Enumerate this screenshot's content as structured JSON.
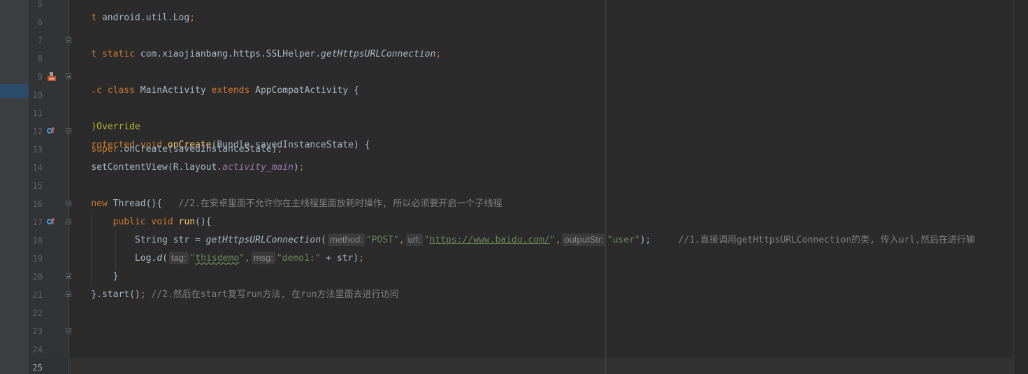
{
  "editor": {
    "line_numbers": [
      "5",
      "6",
      "7",
      "8",
      "9",
      "10",
      "11",
      "12",
      "13",
      "14",
      "15",
      "16",
      "17",
      "18",
      "19",
      "20",
      "21",
      "22",
      "23",
      "24",
      "25"
    ],
    "lines": {
      "l5": {
        "p1": "t ",
        "p2": "android.util.Log",
        "p3": ";"
      },
      "l7": {
        "p1": "t static ",
        "p2": "com.xiaojianbang.https.SSLHelper.",
        "p3": "getHttpsURLConnection",
        "p4": ";"
      },
      "l9": {
        "p1": ".c class ",
        "p2": "MainActivity ",
        "p3": "extends ",
        "p4": "AppCompatActivity {"
      },
      "l11": {
        "p1": ")Override"
      },
      "l12": {
        "p1": "rotected void ",
        "p2": "onCreate",
        "p3": "(Bundle savedInstanceState) {"
      },
      "l13": {
        "p1": "super",
        "p2": ".onCreate(savedInstanceState)",
        "p3": ";"
      },
      "l14": {
        "p1": "setContentView(R.layout.",
        "p2": "activity_main",
        "p3": ")",
        "p4": ";"
      },
      "l16": {
        "p1": "new ",
        "p2": "Thread(){   ",
        "p3": "//2.在安卓里面不允许你在主线程里面放耗时操作, 所以必须要开启一个子线程"
      },
      "l17": {
        "p1": "public void ",
        "p2": "run",
        "p3": "(){"
      },
      "l18": {
        "p1": "String str = ",
        "p2": "getHttpsURLConnection",
        "p3": "(",
        "h1": "method:",
        "s1": "\"POST\"",
        "c1": ",",
        "h2": "url:",
        "s2q1": "\"",
        "s2": "https://www.baidu.com/",
        "s2q2": "\"",
        "c2": ",",
        "h3": "outputStr:",
        "s3": "\"user\"",
        "p4": ");     ",
        "cmt": "//1.直接调用getHttpsURLConnection的类, 传入url,然后在进行输"
      },
      "l19": {
        "p1": "Log.",
        "p2": "d",
        "p3": "(",
        "h1": "tag:",
        "s1q1": "\"",
        "s1": "thisdemo",
        "s1q2": "\"",
        "c1": ",",
        "h2": "msg:",
        "s2": "\"demo1:\"",
        "p4": " + str)",
        "p5": ";"
      },
      "l20": {
        "p1": "}"
      },
      "l21": {
        "p1": "}.start()",
        "p2": "; ",
        "p3": "//2.然后在start复写run方法, 在run方法里面去进行访问"
      }
    }
  },
  "colors": {
    "background": "#2b2b2b",
    "gutter": "#313335",
    "keyword": "#cc7832",
    "function": "#ffc66d",
    "string": "#6a8759",
    "comment": "#808080",
    "annotation": "#bbb529",
    "field": "#9876aa",
    "text": "#a9b7c6"
  },
  "icons": [
    "run-class-icon",
    "override-method-icon",
    "fold-marker-icon"
  ]
}
